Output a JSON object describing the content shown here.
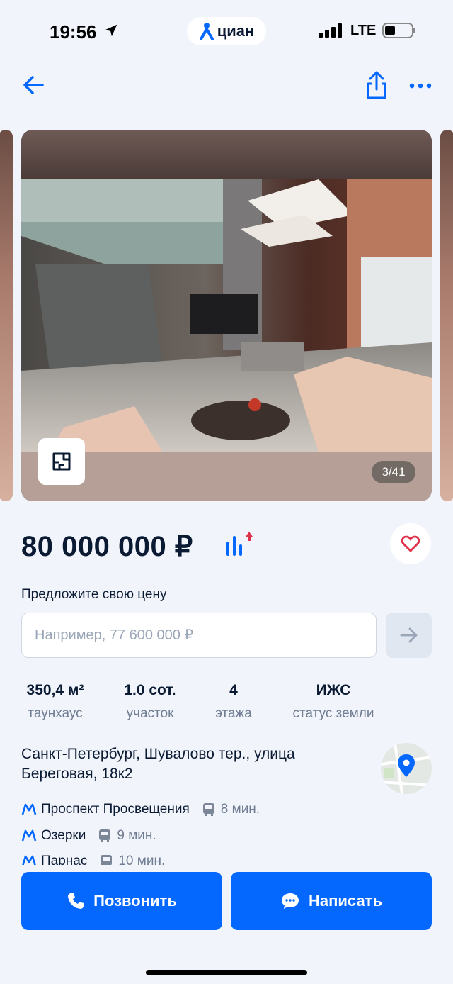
{
  "status_bar": {
    "time": "19:56",
    "network": "LTE",
    "brand": "циан"
  },
  "nav": {
    "back_icon": "arrow-left-icon",
    "share_icon": "share-icon",
    "more_icon": "more-dots-icon"
  },
  "gallery": {
    "counter": "3/41",
    "plan_icon": "floor-plan-icon"
  },
  "listing": {
    "price": "80 000 000 ₽",
    "offer_label": "Предложите свою цену",
    "offer_placeholder": "Например, 77 600 000 ₽",
    "params": [
      {
        "value": "350,4 м²",
        "label": "таунхаус"
      },
      {
        "value": "1.0 сот.",
        "label": "участок"
      },
      {
        "value": "4",
        "label": "этажа"
      },
      {
        "value": "ИЖС",
        "label": "статус земли"
      }
    ],
    "address": "Санкт-Петербург, Шувалово тер., улица Береговая, 18к2",
    "metro": [
      {
        "name": "Проспект Просвещения",
        "time": "8 мин."
      },
      {
        "name": "Озерки",
        "time": "9 мин."
      },
      {
        "name": "Парнас",
        "time": "10 мин."
      }
    ]
  },
  "actions": {
    "call": "Позвонить",
    "write": "Написать"
  },
  "colors": {
    "accent": "#0468ff",
    "metro": "#0468ff",
    "favorite": "#e0324b",
    "background": "#f1f5fb"
  }
}
